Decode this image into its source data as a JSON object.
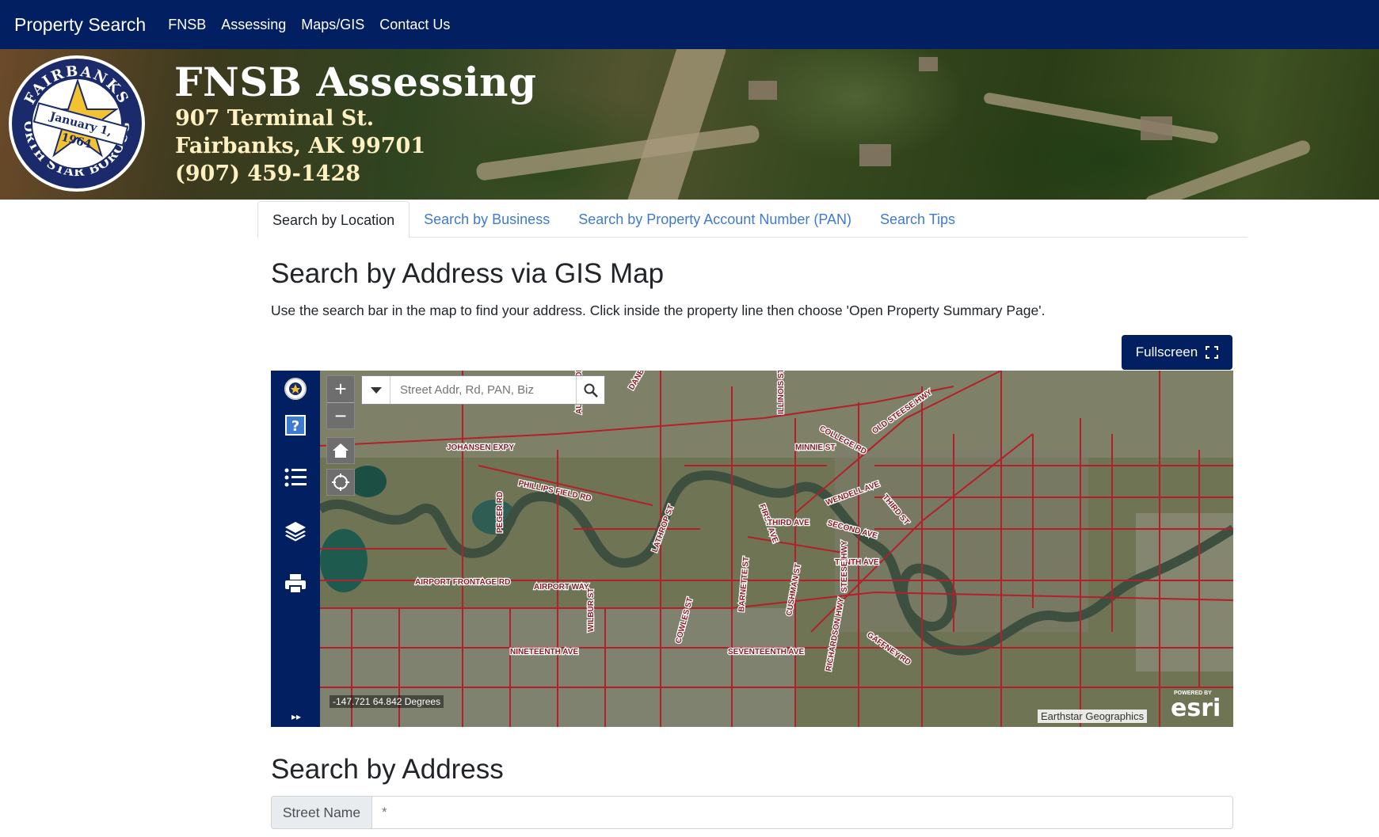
{
  "navbar": {
    "brand": "Property Search",
    "links": [
      "FNSB",
      "Assessing",
      "Maps/GIS",
      "Contact Us"
    ]
  },
  "banner": {
    "title": "FNSB Assessing",
    "address_line1": "907 Terminal St.",
    "address_line2": "Fairbanks, AK 99701",
    "phone": "(907) 459-1428",
    "seal": {
      "ring_text_top": "FAIRBANKS",
      "ring_text_bottom": "NORTH STAR BOROUGH",
      "ribbon": "January 1, 1964"
    }
  },
  "tabs": [
    {
      "label": "Search by Location",
      "active": true
    },
    {
      "label": "Search by Business",
      "active": false
    },
    {
      "label": "Search by Property Account Number (PAN)",
      "active": false
    },
    {
      "label": "Search Tips",
      "active": false
    }
  ],
  "gis_section": {
    "heading": "Search by Address via GIS Map",
    "instructions": "Use the search bar in the map to find your address. Click inside the property line then choose 'Open Property Summary Page'.",
    "fullscreen_label": "Fullscreen"
  },
  "map": {
    "search_placeholder": "Street Addr, Rd, PAN, Biz",
    "coordinates": "-147.721 64.842 Degrees",
    "attribution": "Earthstar Geographics",
    "esri_powered": "POWERED BY",
    "esri_logo": "esri",
    "street_labels": [
      "JOHANSEN EXPY",
      "PHILLIPS FIELD RD",
      "PEGER RD",
      "AIRPORT FRONTAGE RD",
      "AIRPORT WAY",
      "NINETEENTH AVE",
      "WILBUR ST",
      "COLLEGE RD",
      "OLD STEESE HWY",
      "MINNIE ST",
      "ILLINOIS ST",
      "THIRD ST",
      "WENDELL AVE",
      "SECOND AVE",
      "FIRST AVE",
      "THIRD AVE",
      "TENTH AVE",
      "STEESE HWY",
      "GAFFNEY RD",
      "SEVENTEENTH AVE",
      "RICHARDSON HWY",
      "CUSHMAN ST",
      "BARNETTE ST",
      "LATHROP ST",
      "COWLES ST",
      "DANBY ST",
      "AURORA DR"
    ],
    "colors": {
      "sidebar": "#022061",
      "parcel_lines": "#b3202a"
    }
  },
  "address_section": {
    "heading": "Search by Address",
    "street_label": "Street Name",
    "street_placeholder": "*"
  }
}
